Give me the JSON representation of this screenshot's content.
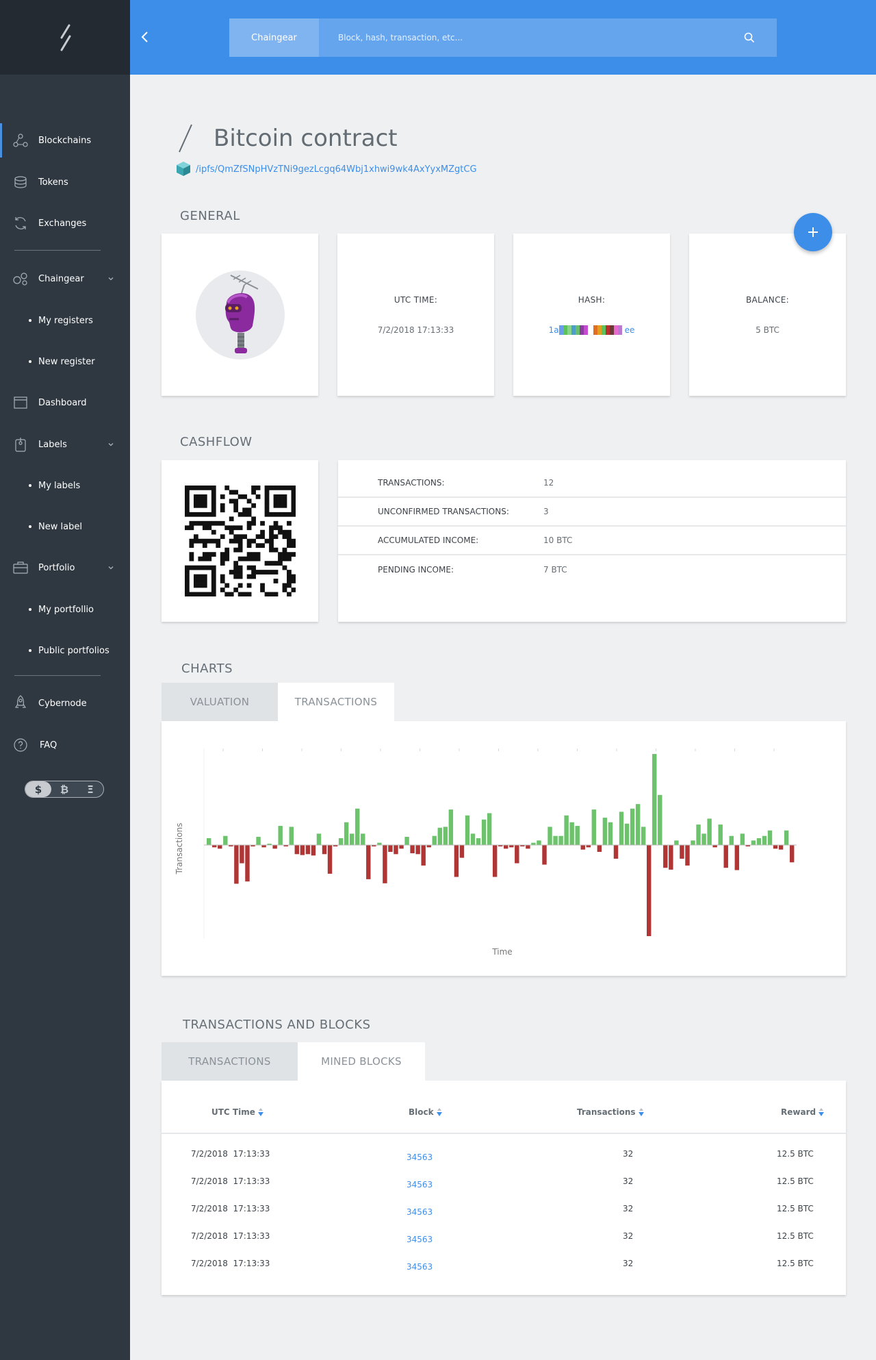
{
  "search": {
    "tag": "Chaingear",
    "placeholder": "Block, hash, transaction, etc..."
  },
  "sidebar": {
    "items": {
      "blockchains": "Blockchains",
      "tokens": "Tokens",
      "exchanges": "Exchanges",
      "chaingear": "Chaingear",
      "my_registers": "My registers",
      "new_register": "New register",
      "dashboard": "Dashboard",
      "labels": "Labels",
      "my_labels": "My labels",
      "new_label": "New label",
      "portfolio": "Portfolio",
      "my_portfollio": "My portfollio",
      "public_portfolios": "Public portfolios",
      "cybernode": "Cybernode",
      "faq": "FAQ"
    },
    "currency": [
      "$",
      "₿",
      "Ξ"
    ],
    "currency_selected": "$"
  },
  "page": {
    "title": "Bitcoin contract",
    "ipfs": "/ipfs/QmZfSNpHVzTNi9gezLcgq64Wbj1xhwi9wk4AxYyxMZgtCG"
  },
  "general": {
    "title": "GENERAL",
    "utc_label": "UTC TIME:",
    "utc_value": "7/2/2018 17:13:33",
    "hash_label": "HASH:",
    "hash_prefix": "1a",
    "hash_suffix": "ee",
    "balance_label": "BALANCE:",
    "balance_value": "5 BTC"
  },
  "cashflow": {
    "title": "CASHFLOW",
    "rows": [
      {
        "label": "TRANSACTIONS:",
        "value": "12"
      },
      {
        "label": "UNCONFIRMED TRANSACTIONS:",
        "value": "3"
      },
      {
        "label": "ACCUMULATED INCOME:",
        "value": "10 BTC"
      },
      {
        "label": "PENDING INCOME:",
        "value": "7 BTC"
      }
    ]
  },
  "charts": {
    "title": "CHARTS",
    "tabs": [
      "VALUATION",
      "TRANSACTIONS"
    ],
    "active_tab": "TRANSACTIONS"
  },
  "chart_data": {
    "type": "bar",
    "xlabel": "Time",
    "ylabel": "Transactions",
    "colors": {
      "positive": "#6cc36c",
      "negative": "#b03535"
    },
    "values": [
      1.5,
      -0.5,
      -0.8,
      2.0,
      -0.3,
      -8.5,
      -4.0,
      -8.0,
      -0.3,
      1.8,
      -0.5,
      0.3,
      -0.8,
      4.2,
      -0.3,
      4.0,
      -2.0,
      -2.2,
      -2.0,
      -2.3,
      2.5,
      -2.0,
      -6.3,
      -0.3,
      1.5,
      5.0,
      2.5,
      8.0,
      2.5,
      -7.5,
      -0.3,
      0.5,
      -8.4,
      -1.5,
      -2.0,
      -0.8,
      1.8,
      -1.8,
      -2.0,
      -4.5,
      -0.5,
      2.0,
      3.8,
      4.0,
      7.8,
      -7.0,
      -2.8,
      6.5,
      2.5,
      1.5,
      5.6,
      7.0,
      -7.0,
      -0.3,
      -0.8,
      -0.5,
      -4.0,
      -0.3,
      -0.8,
      0.5,
      1.0,
      -4.3,
      4.0,
      2.0,
      2.0,
      6.5,
      5.0,
      4.2,
      -1.0,
      -0.5,
      7.8,
      -1.5,
      6.0,
      5.0,
      -3.0,
      7.3,
      4.7,
      8.0,
      9.0,
      4.0,
      -20.0,
      20.0,
      11.0,
      -5.0,
      -5.4,
      1.0,
      -3.0,
      -4.5,
      1.0,
      4.5,
      2.5,
      5.8,
      -0.5,
      4.5,
      -5.0,
      2.0,
      -5.5,
      2.5,
      -0.3,
      1.0,
      1.5,
      2.0,
      3.2,
      -0.8,
      -1.0,
      3.2,
      -3.8
    ]
  },
  "txblocks": {
    "title": "TRANSACTIONS AND BLOCKS",
    "tabs": [
      "TRANSACTIONS",
      "MINED BLOCKS"
    ],
    "active_tab": "MINED BLOCKS",
    "columns": [
      "UTC Time",
      "Block",
      "Transactions",
      "Reward"
    ],
    "rows": [
      {
        "time": "7/2/2018  17:13:33",
        "block": "34563",
        "tx": "32",
        "reward": "12.5 BTC"
      },
      {
        "time": "7/2/2018  17:13:33",
        "block": "34563",
        "tx": "32",
        "reward": "12.5 BTC"
      },
      {
        "time": "7/2/2018  17:13:33",
        "block": "34563",
        "tx": "32",
        "reward": "12.5 BTC"
      },
      {
        "time": "7/2/2018  17:13:33",
        "block": "34563",
        "tx": "32",
        "reward": "12.5 BTC"
      },
      {
        "time": "7/2/2018  17:13:33",
        "block": "34563",
        "tx": "32",
        "reward": "12.5 BTC"
      }
    ]
  }
}
